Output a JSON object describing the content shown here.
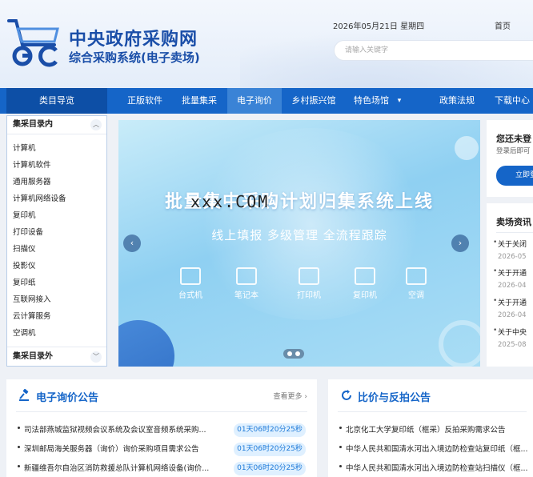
{
  "header": {
    "title": "中央政府采购网",
    "subtitle": "综合采购系统(电子卖场)",
    "date": "2026年05月21日 星期四",
    "home_link": "首页",
    "search_placeholder": "请输入关键字"
  },
  "nav": {
    "category": "类目导览",
    "items": [
      "正版软件",
      "批量集采",
      "电子询价",
      "乡村振兴馆",
      "特色场馆",
      "政策法规",
      "下载中心"
    ],
    "active": "电子询价"
  },
  "sidebar": {
    "inner_title": "集采目录内",
    "items": [
      "计算机",
      "计算机软件",
      "通用服务器",
      "计算机网络设备",
      "复印机",
      "打印设备",
      "扫描仪",
      "投影仪",
      "复印纸",
      "互联网接入",
      "云计算服务",
      "空调机"
    ],
    "outer_title": "集采目录外"
  },
  "banner": {
    "title": "批量集中采购计划归集系统上线",
    "watermark": "xxx.COM",
    "subtitle": "线上填报 多级管理 全流程跟踪",
    "icons": [
      {
        "label": "台式机",
        "icon": "desktop-icon"
      },
      {
        "label": "笔记本",
        "icon": "laptop-icon"
      },
      {
        "label": "打印机",
        "icon": "printer-icon"
      },
      {
        "label": "复印机",
        "icon": "copier-icon"
      },
      {
        "label": "空调",
        "icon": "air-conditioner-icon"
      }
    ]
  },
  "login": {
    "title": "您还未登",
    "desc": "登录后即可",
    "button": "立即登"
  },
  "news": {
    "title": "卖场资讯",
    "items": [
      {
        "title": "关于关闭",
        "date": "2026-05"
      },
      {
        "title": "关于开通",
        "date": "2026-04"
      },
      {
        "title": "关于开通",
        "date": "2026-04"
      },
      {
        "title": "关于中央",
        "date": "2025-08"
      }
    ]
  },
  "inquiry": {
    "title": "电子询价公告",
    "more": "查看更多 ›",
    "rows": [
      {
        "text": "司法部燕城监狱视频会议系统及会议室音频系统采购...",
        "tag": "01天06时20分25秒"
      },
      {
        "text": "深圳邮局海关服务器（询价）询价采购项目需求公告",
        "tag": "01天06时20分25秒"
      },
      {
        "text": "新疆维吾尔自治区消防救援总队计算机网络设备(询价...",
        "tag": "01天06时20分25秒"
      }
    ]
  },
  "bidding": {
    "title": "比价与反拍公告",
    "rows": [
      {
        "text": "北京化工大学复印纸（框采）反拍采购需求公告"
      },
      {
        "text": "中华人民共和国清水河出入境边防检查站复印纸（框..."
      },
      {
        "text": "中华人民共和国清水河出入境边防检查站扫描仪（框..."
      }
    ]
  },
  "colors": {
    "brand": "#1565c8",
    "nav_dark": "#0d4fa6",
    "tag_bg": "#dff0ff"
  }
}
